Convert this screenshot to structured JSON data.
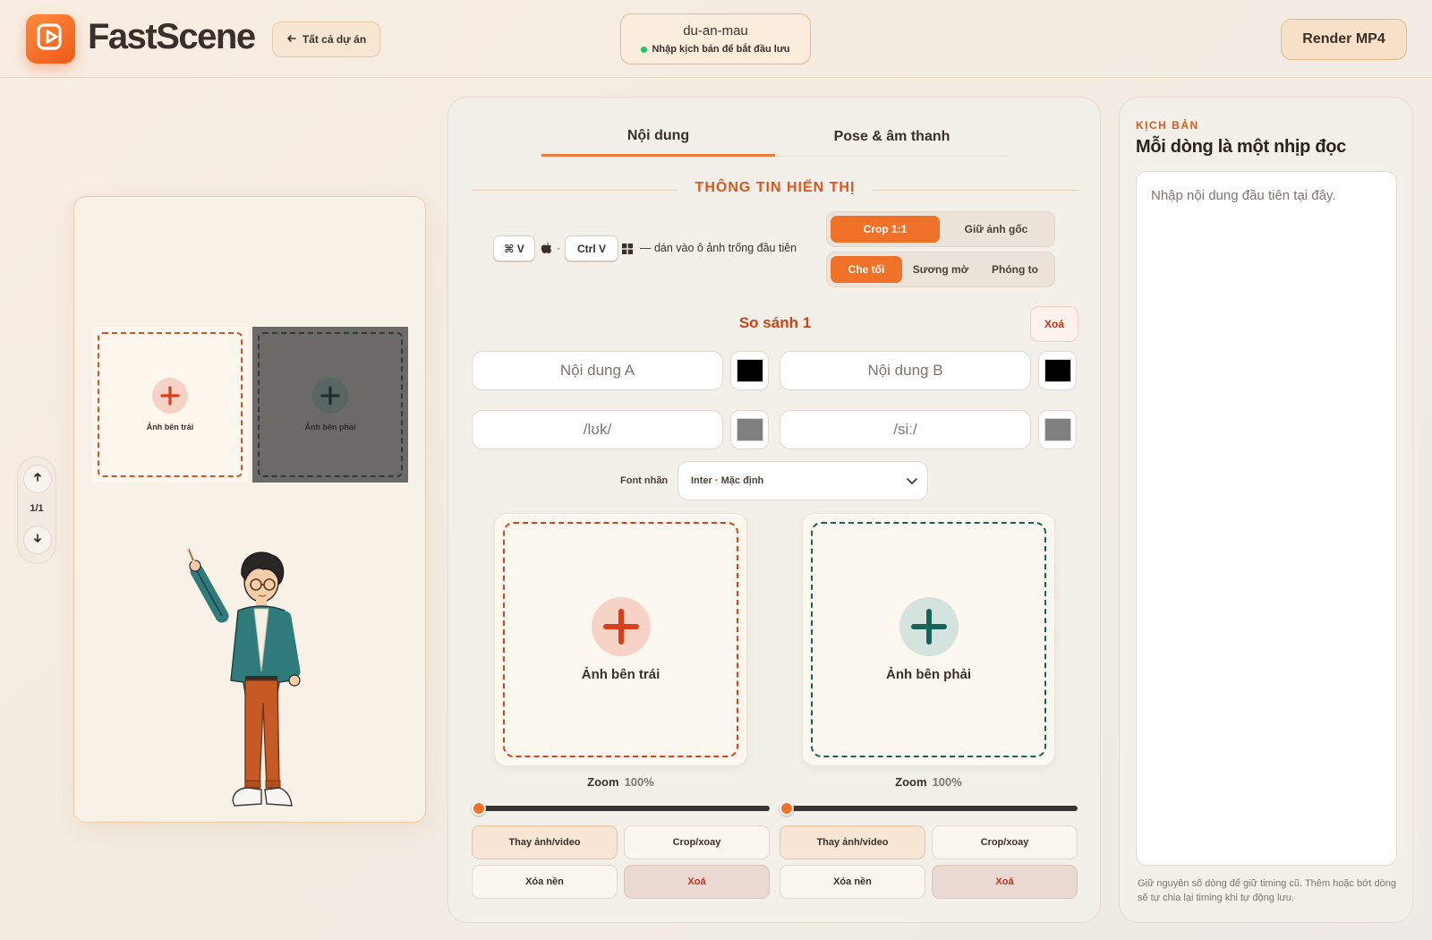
{
  "header": {
    "brand": "FastScene",
    "back_label": "Tất cả dự án",
    "project_name": "du-an-mau",
    "project_status": "Nhập kịch bản để bắt đầu lưu",
    "render_label": "Render MP4"
  },
  "preview": {
    "left_label": "Ảnh bên trái",
    "right_label": "Ảnh bên phải",
    "page_counter": "1/1"
  },
  "editor": {
    "tabs": [
      "Nội dung",
      "Pose & âm thanh"
    ],
    "section_title": "THÔNG TIN HIỂN THỊ",
    "shortcut_mac": "⌘ V",
    "shortcut_sep": "·",
    "shortcut_win": "Ctrl V",
    "paste_hint": "— dán vào ô ảnh trống đầu tiên",
    "crop_options": [
      "Crop 1:1",
      "Giữ ảnh gốc"
    ],
    "crop_selected": "Crop 1:1",
    "bg_options": [
      "Che tối",
      "Sương mờ",
      "Phóng to"
    ],
    "bg_selected": "Che tối",
    "comparison_title": "So sánh 1",
    "delete_label": "Xoá",
    "content_a_placeholder": "Nội dung A",
    "content_b_placeholder": "Nội dung B",
    "phonetic_a": "/lʊk/",
    "phonetic_b": "/siː/",
    "color_a": "#000000",
    "color_b": "#000000",
    "phonetic_color_a": "#808080",
    "phonetic_color_b": "#808080",
    "font_label": "Font nhãn",
    "font_value": "Inter · Mặc định",
    "left_card": {
      "label": "Ảnh bên trái",
      "zoom_label": "Zoom",
      "zoom_value": "100%",
      "replace": "Thay ảnh/video",
      "crop": "Crop/xoay",
      "remove_bg": "Xóa nền",
      "delete": "Xoá",
      "accent": "#d7401b"
    },
    "right_card": {
      "label": "Ảnh bên phải",
      "zoom_label": "Zoom",
      "zoom_value": "100%",
      "replace": "Thay ảnh/video",
      "crop": "Crop/xoay",
      "remove_bg": "Xóa nền",
      "delete": "Xoá",
      "accent": "#16635c"
    }
  },
  "script": {
    "kicker": "KỊCH BẢN",
    "title": "Mỗi dòng là một nhịp đọc",
    "placeholder": "Nhập nội dung đầu tiên tại đây.",
    "note": "Giữ nguyên số dòng để giữ timing cũ. Thêm hoặc bớt dòng sẽ tự chia lại timing khi tự động lưu."
  },
  "colors": {
    "brand_orange": "#f07229",
    "accent_red": "#d7401b",
    "accent_teal": "#16635c",
    "status_green": "#22c55e"
  }
}
